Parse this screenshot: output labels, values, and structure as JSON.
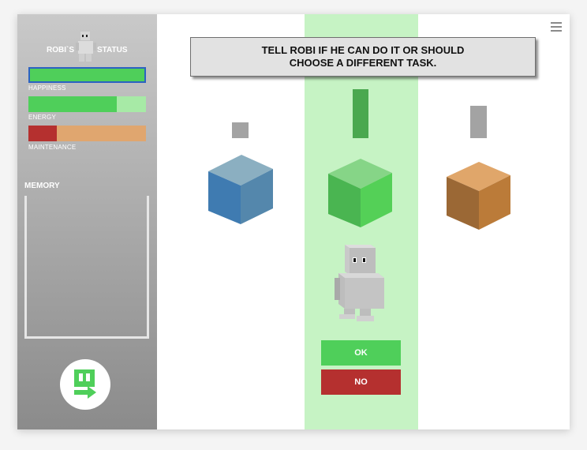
{
  "sidebar": {
    "status_left": "ROBI`S",
    "status_right": "STATUS",
    "bars": [
      {
        "label": "HAPPINESS",
        "value": 1.0,
        "fill": "#4fcf5a",
        "track": "#a7eaa6",
        "outline": "#2c62c2"
      },
      {
        "label": "ENERGY",
        "value": 0.75,
        "fill": "#4fcf5a",
        "track": "#a7eaa6"
      },
      {
        "label": "MAINTENANCE",
        "value": 0.24,
        "fill": "#b5302f",
        "track": "#e0a66f"
      }
    ],
    "memory_title": "MEMORY",
    "proceed_icon": "exit-door-arrow-icon"
  },
  "prompt": {
    "line1": "TELL ROBI IF HE CAN DO IT OR SHOULD",
    "line2": "CHOOSE A DIFFERENT TASK."
  },
  "menu_icon": "hamburger-menu-icon",
  "tasks": [
    {
      "color": "blue",
      "indicator_level": 0.33
    },
    {
      "color": "green",
      "indicator_level": 1.0,
      "selected": true
    },
    {
      "color": "orange",
      "indicator_level": 0.66
    }
  ],
  "buttons": {
    "ok_label": "OK",
    "no_label": "NO",
    "ok_color": "#4fcf5a",
    "no_color": "#b5302f"
  },
  "colors": {
    "selected_lane": "#c6f3c4",
    "sidebar_top": "#c9c9c9",
    "sidebar_bottom": "#8b8b8b"
  }
}
